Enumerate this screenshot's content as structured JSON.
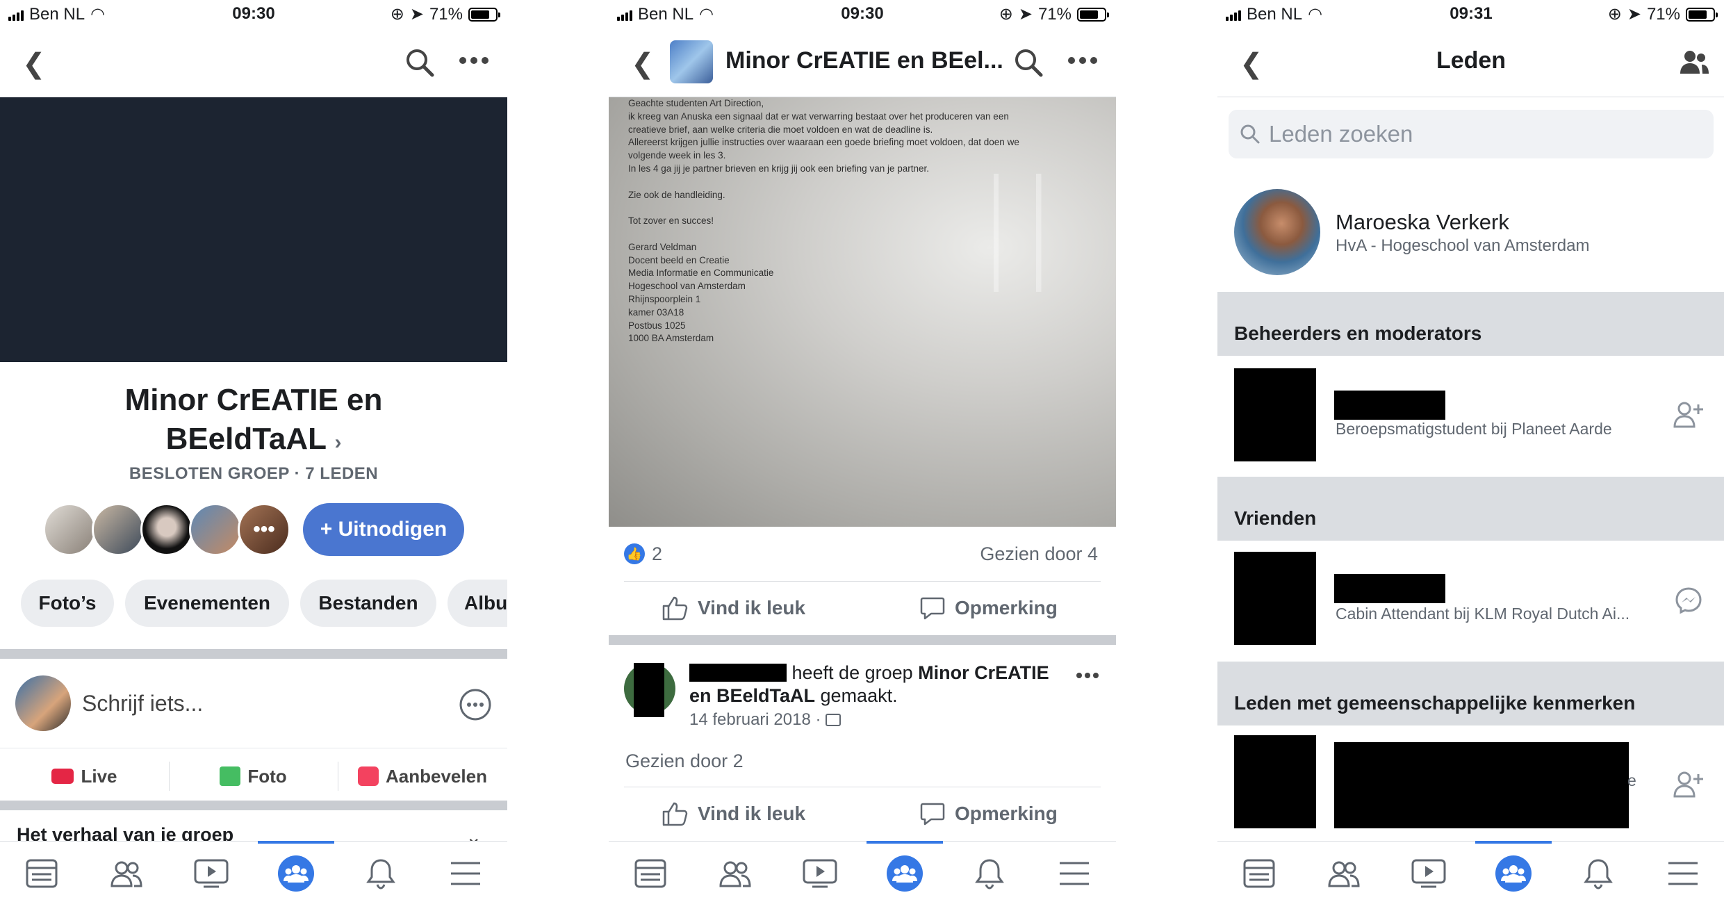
{
  "status": {
    "s1": {
      "carrier": "Ben NL",
      "time": "09:30",
      "battery": "71%"
    },
    "s2": {
      "carrier": "Ben NL",
      "time": "09:30",
      "battery": "71%"
    },
    "s3": {
      "carrier": "Ben NL",
      "time": "09:31",
      "battery": "71%"
    }
  },
  "group": {
    "name_line1": "Minor CrEATIE en",
    "name_line2": "BEeldTaAL",
    "meta": "BESLOTEN GROEP · 7 LEDEN",
    "invite_label": "+ Uitnodigen",
    "tabs": [
      "Foto’s",
      "Evenementen",
      "Bestanden",
      "Albu"
    ],
    "composer_placeholder": "Schrijf iets...",
    "actions": [
      "Live",
      "Foto",
      "Aanbevelen"
    ],
    "story_title": "Het verhaal van je groep"
  },
  "post": {
    "header_title": "Minor CrEATIE en BEel...",
    "letter_lines": [
      "Geachte studenten Art Direction,",
      "ik kreeg van Anuska een signaal dat er wat verwarring bestaat over het produceren van een",
      "creatieve brief, aan welke criteria die moet voldoen en wat de deadline is.",
      "Allereerst krijgen jullie instructies over waaraan een goede briefing moet voldoen, dat doen we",
      "volgende week in les 3.",
      "In les 4 ga jij je partner brieven en krijg jij ook een briefing van je partner.",
      "",
      "Zie ook de handleiding.",
      "",
      "Tot zover en succes!",
      "",
      "Gerard Veldman",
      "Docent beeld en Creatie",
      "Media Informatie en Communicatie",
      "Hogeschool van Amsterdam",
      "Rhijnspoorplein 1",
      "kamer 03A18",
      "Postbus 1025",
      "1000 BA Amsterdam"
    ],
    "likes": "2",
    "seen": "Gezien door 4",
    "like_label": "Vind ik leuk",
    "comment_label": "Opmerking",
    "post2_text_a": " heeft de groep ",
    "post2_group": "Minor CrEATIE en BEeldTaAL",
    "post2_text_b": " gemaakt.",
    "post2_date": "14 februari 2018 ·",
    "post2_seen": "Gezien door 2"
  },
  "members": {
    "title": "Leden",
    "search_placeholder": "Leden zoeken",
    "me_name": "Maroeska Verkerk",
    "me_sub": "HvA - Hogeschool van Amsterdam",
    "sections": [
      "Beheerders en moderators",
      "Vrienden",
      "Leden met gemeenschappelijke kenmerken"
    ],
    "admin_sub": "Beroepsmatigstudent bij Planeet Aarde",
    "friend_sub": "Cabin Attendant bij KLM Royal Dutch Ai...",
    "third_tail": "e"
  },
  "colors": {
    "accent": "#3578e5",
    "cover": "#1c2431",
    "separator": "#c9ccd1"
  },
  "icons": [
    "back-icon",
    "search-icon",
    "more-icon",
    "camera-icon",
    "photo-icon",
    "recommend-icon",
    "like-icon",
    "comment-icon",
    "add-friend-icon",
    "messenger-icon",
    "news-feed-icon",
    "friends-icon",
    "watch-icon",
    "groups-icon",
    "bell-icon",
    "menu-icon"
  ]
}
